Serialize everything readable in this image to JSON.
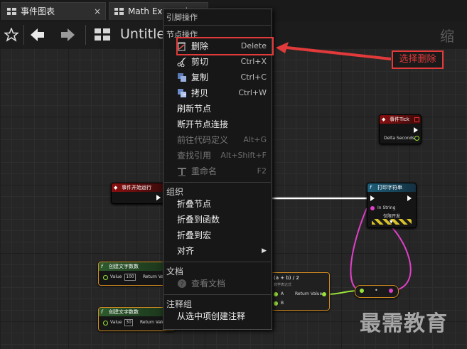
{
  "tabs": [
    {
      "label": "事件图表",
      "close": "×"
    },
    {
      "label": "Math Expression"
    }
  ],
  "toolbar": {
    "title": "Untitled",
    "zoom": "缩放"
  },
  "menu": {
    "section_pins": "引脚操作",
    "section_nodes": "节点操作",
    "items_nodes": [
      {
        "label": "删除",
        "shortcut": "Delete",
        "icon": "delete-icon"
      },
      {
        "label": "剪切",
        "shortcut": "Ctrl+X",
        "icon": "scissors-icon"
      },
      {
        "label": "复制",
        "shortcut": "Ctrl+C",
        "icon": "copy-icon"
      },
      {
        "label": "拷贝",
        "shortcut": "Ctrl+W",
        "icon": "duplicate-icon"
      },
      {
        "label": "刷新节点",
        "shortcut": ""
      },
      {
        "label": "断开节点连接",
        "shortcut": ""
      },
      {
        "label": "前往代码定义",
        "shortcut": "Alt+G",
        "disabled": true
      },
      {
        "label": "查找引用",
        "shortcut": "Alt+Shift+F",
        "disabled": true
      },
      {
        "label": "重命名",
        "shortcut": "F2",
        "disabled": true,
        "icon": "rename-icon"
      }
    ],
    "section_org": "组织",
    "items_org": [
      {
        "label": "折叠节点"
      },
      {
        "label": "折叠到函数"
      },
      {
        "label": "折叠到宏"
      },
      {
        "label": "对齐",
        "submenu": "▶"
      }
    ],
    "section_doc": "文档",
    "items_doc": [
      {
        "label": "查看文档",
        "disabled": true,
        "icon": "help-icon"
      }
    ],
    "section_comment": "注释组",
    "items_comment": [
      {
        "label": "从选中项创建注释"
      }
    ]
  },
  "annotation": {
    "text": "选择删除",
    "color": "#e23a3a"
  },
  "nodes": {
    "event_tick": {
      "title": "事件Tick",
      "pin": "Delta Seconds"
    },
    "begin_play": {
      "title": "事件开始运行"
    },
    "print_string": {
      "title": "打印字符串",
      "pin_in": "In String",
      "dev_only": "仅限开发"
    },
    "make_literal_1": {
      "title": "创建文字数数",
      "pin_label": "Value",
      "value": "100",
      "ret": "Return Value"
    },
    "make_literal_2": {
      "title": "创建文字数数",
      "pin_label": "Value",
      "value": "30",
      "ret": "Return Value"
    },
    "math": {
      "title": "(a + b) / 2",
      "subtitle": "数学表达式",
      "pin_a": "A",
      "pin_b": "B",
      "ret": "Return Value"
    }
  },
  "watermark": "最需教育",
  "colors": {
    "accent": "#e23a3a",
    "exec_wire": "#ffffff",
    "float_wire": "#9ae23a",
    "string_wire": "#e040c8"
  }
}
